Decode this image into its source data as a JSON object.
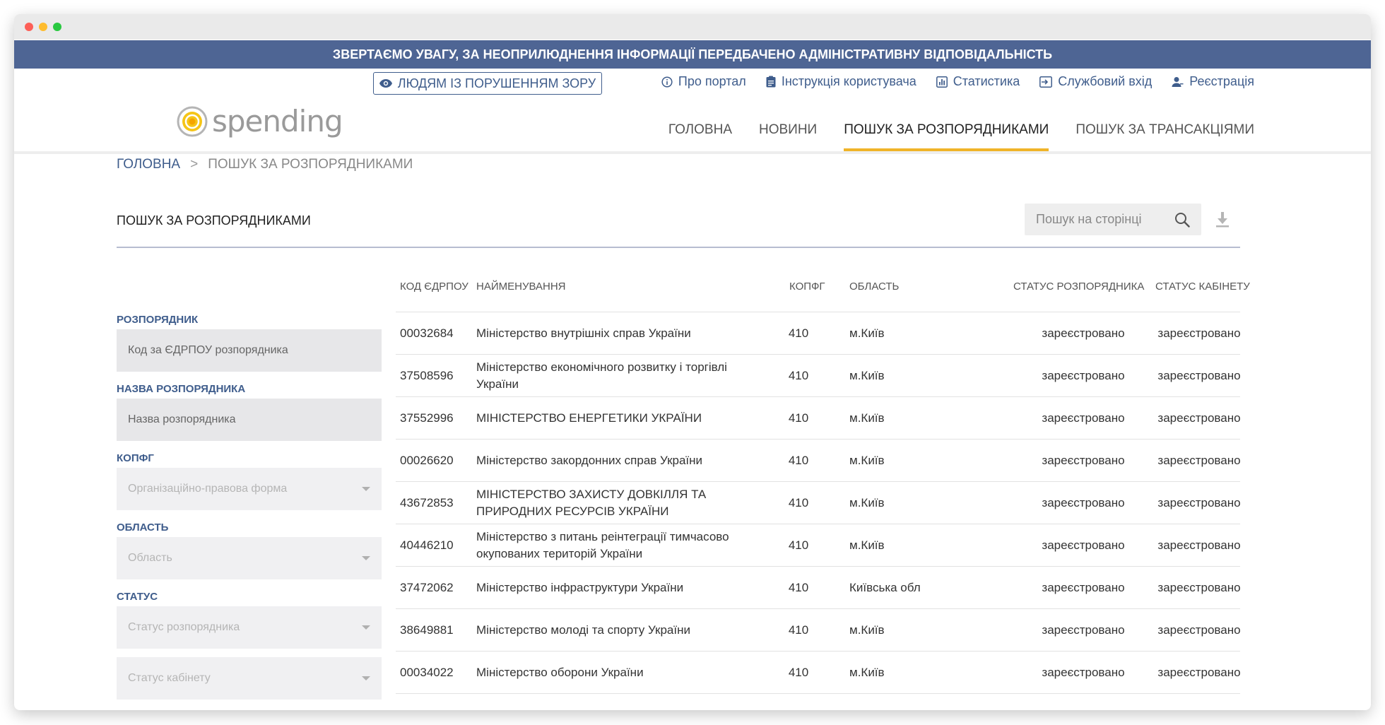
{
  "banner": "ЗВЕРТАЄМО УВАГУ, ЗА НЕОПРИЛЮДНЕННЯ ІНФОРМАЦІЇ ПЕРЕДБАЧЕНО АДМІНІСТРАТИВНУ ВІДПОВІДАЛЬНІСТЬ",
  "header": {
    "vision_button": "ЛЮДЯМ ІЗ ПОРУШЕННЯМ ЗОРУ",
    "links": {
      "about": "Про портал",
      "manual": "Інструкція користувача",
      "stats": "Статистика",
      "login": "Службовий вхід",
      "register": "Реєстрація"
    },
    "logo_text": "spending",
    "nav": [
      "ГОЛОВНА",
      "НОВИНИ",
      "ПОШУК ЗА РОЗПОРЯДНИКАМИ",
      "ПОШУК ЗА ТРАНСАКЦІЯМИ"
    ],
    "active_nav": "ПОШУК ЗА РОЗПОРЯДНИКАМИ"
  },
  "breadcrumb": {
    "home": "ГОЛОВНА",
    "separator": ">",
    "current": "ПОШУК ЗА РОЗПОРЯДНИКАМИ"
  },
  "page_title": "ПОШУК ЗА РОЗПОРЯДНИКАМИ",
  "search": {
    "placeholder": "Пошук на сторінці"
  },
  "filters": {
    "manager_label": "РОЗПОРЯДНИК",
    "manager_placeholder": "Код за ЄДРПОУ розпорядника",
    "name_label": "НАЗВА РОЗПОРЯДНИКА",
    "name_placeholder": "Назва розпорядника",
    "kopfg_label": "КОПФГ",
    "kopfg_placeholder": "Організаційно-правова форма",
    "region_label": "ОБЛАСТЬ",
    "region_placeholder": "Область",
    "status_label": "СТАТУС",
    "status_manager_placeholder": "Статус розпорядника",
    "status_cabinet_placeholder": "Статус кабінету"
  },
  "table": {
    "columns": {
      "code": "КОД ЄДРПОУ",
      "name": "НАЙМЕНУВАННЯ",
      "kopfg": "КОПФГ",
      "region": "ОБЛАСТЬ",
      "status": "СТАТУС РОЗПОРЯДНИКА",
      "cabinet": "СТАТУС КАБІНЕТУ"
    },
    "rows": [
      {
        "code": "00032684",
        "name": "Міністерство внутрішніх справ України",
        "kopfg": "410",
        "region": "м.Київ",
        "status": "зареєстровано",
        "cabinet": "зареєстровано"
      },
      {
        "code": "37508596",
        "name": "Міністерство економічного розвитку і торгівлі України",
        "kopfg": "410",
        "region": "м.Київ",
        "status": "зареєстровано",
        "cabinet": "зареєстровано"
      },
      {
        "code": "37552996",
        "name": "МІНІСТЕРСТВО ЕНЕРГЕТИКИ УКРАЇНИ",
        "kopfg": "410",
        "region": "м.Київ",
        "status": "зареєстровано",
        "cabinet": "зареєстровано"
      },
      {
        "code": "00026620",
        "name": "Міністерство закордонних справ України",
        "kopfg": "410",
        "region": "м.Київ",
        "status": "зареєстровано",
        "cabinet": "зареєстровано"
      },
      {
        "code": "43672853",
        "name": "МІНІСТЕРСТВО ЗАХИСТУ ДОВКІЛЛЯ ТА ПРИРОДНИХ РЕСУРСІВ УКРАЇНИ",
        "kopfg": "410",
        "region": "м.Київ",
        "status": "зареєстровано",
        "cabinet": "зареєстровано"
      },
      {
        "code": "40446210",
        "name": "Міністерство з питань реінтеграції тимчасово окупованих територій України",
        "kopfg": "410",
        "region": "м.Київ",
        "status": "зареєстровано",
        "cabinet": "зареєстровано"
      },
      {
        "code": "37472062",
        "name": "Міністерство інфраструктури України",
        "kopfg": "410",
        "region": "Київська обл",
        "status": "зареєстровано",
        "cabinet": "зареєстровано"
      },
      {
        "code": "38649881",
        "name": "Міністерство молоді та спорту України",
        "kopfg": "410",
        "region": "м.Київ",
        "status": "зареєстровано",
        "cabinet": "зареєстровано"
      },
      {
        "code": "00034022",
        "name": "Міністерство оборони України",
        "kopfg": "410",
        "region": "м.Київ",
        "status": "зареєстровано",
        "cabinet": "зареєстровано"
      }
    ]
  },
  "colors": {
    "banner": "#4e6594",
    "link": "#3f5d8c",
    "accent": "#f0b429"
  }
}
